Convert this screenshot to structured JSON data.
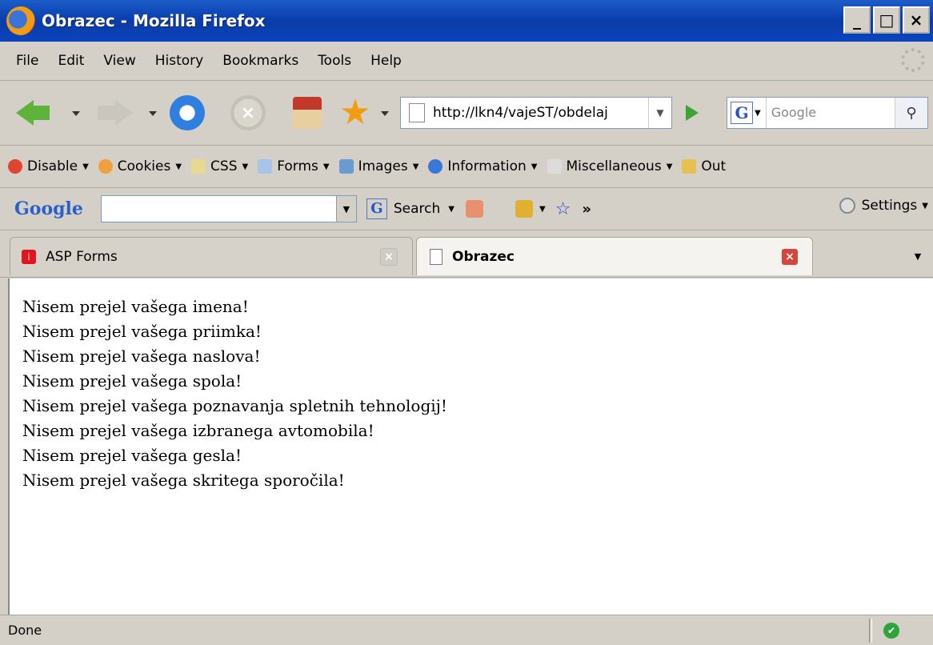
{
  "window": {
    "title": "Obrazec - Mozilla Firefox"
  },
  "menu": [
    "File",
    "Edit",
    "View",
    "History",
    "Bookmarks",
    "Tools",
    "Help"
  ],
  "navigation": {
    "url": "http://lkn4/vajeST/obdelaj",
    "search_placeholder": "Google"
  },
  "devtoolbar": {
    "items": [
      "Disable",
      "Cookies",
      "CSS",
      "Forms",
      "Images",
      "Information",
      "Miscellaneous",
      "Out"
    ]
  },
  "googlebar": {
    "logo": "Google",
    "search_label": "Search",
    "more": "»",
    "settings_label": "Settings"
  },
  "tabs": [
    {
      "label": "ASP Forms"
    },
    {
      "label": "Obrazec"
    }
  ],
  "content": {
    "lines": [
      "Nisem prejel vašega imena!",
      "Nisem prejel vašega priimka!",
      "Nisem prejel vašega naslova!",
      "Nisem prejel vašega spola!",
      "Nisem prejel vašega poznavanja spletnih tehnologij!",
      "Nisem prejel vašega izbranega avtomobila!",
      "Nisem prejel vašega gesla!",
      "Nisem prejel vašega skritega sporočila!"
    ]
  },
  "status": {
    "text": "Done"
  },
  "colors": {
    "title_bar": "#0a44bf",
    "content_bg": "#ffffff",
    "status_ok": "#2ea53a"
  }
}
